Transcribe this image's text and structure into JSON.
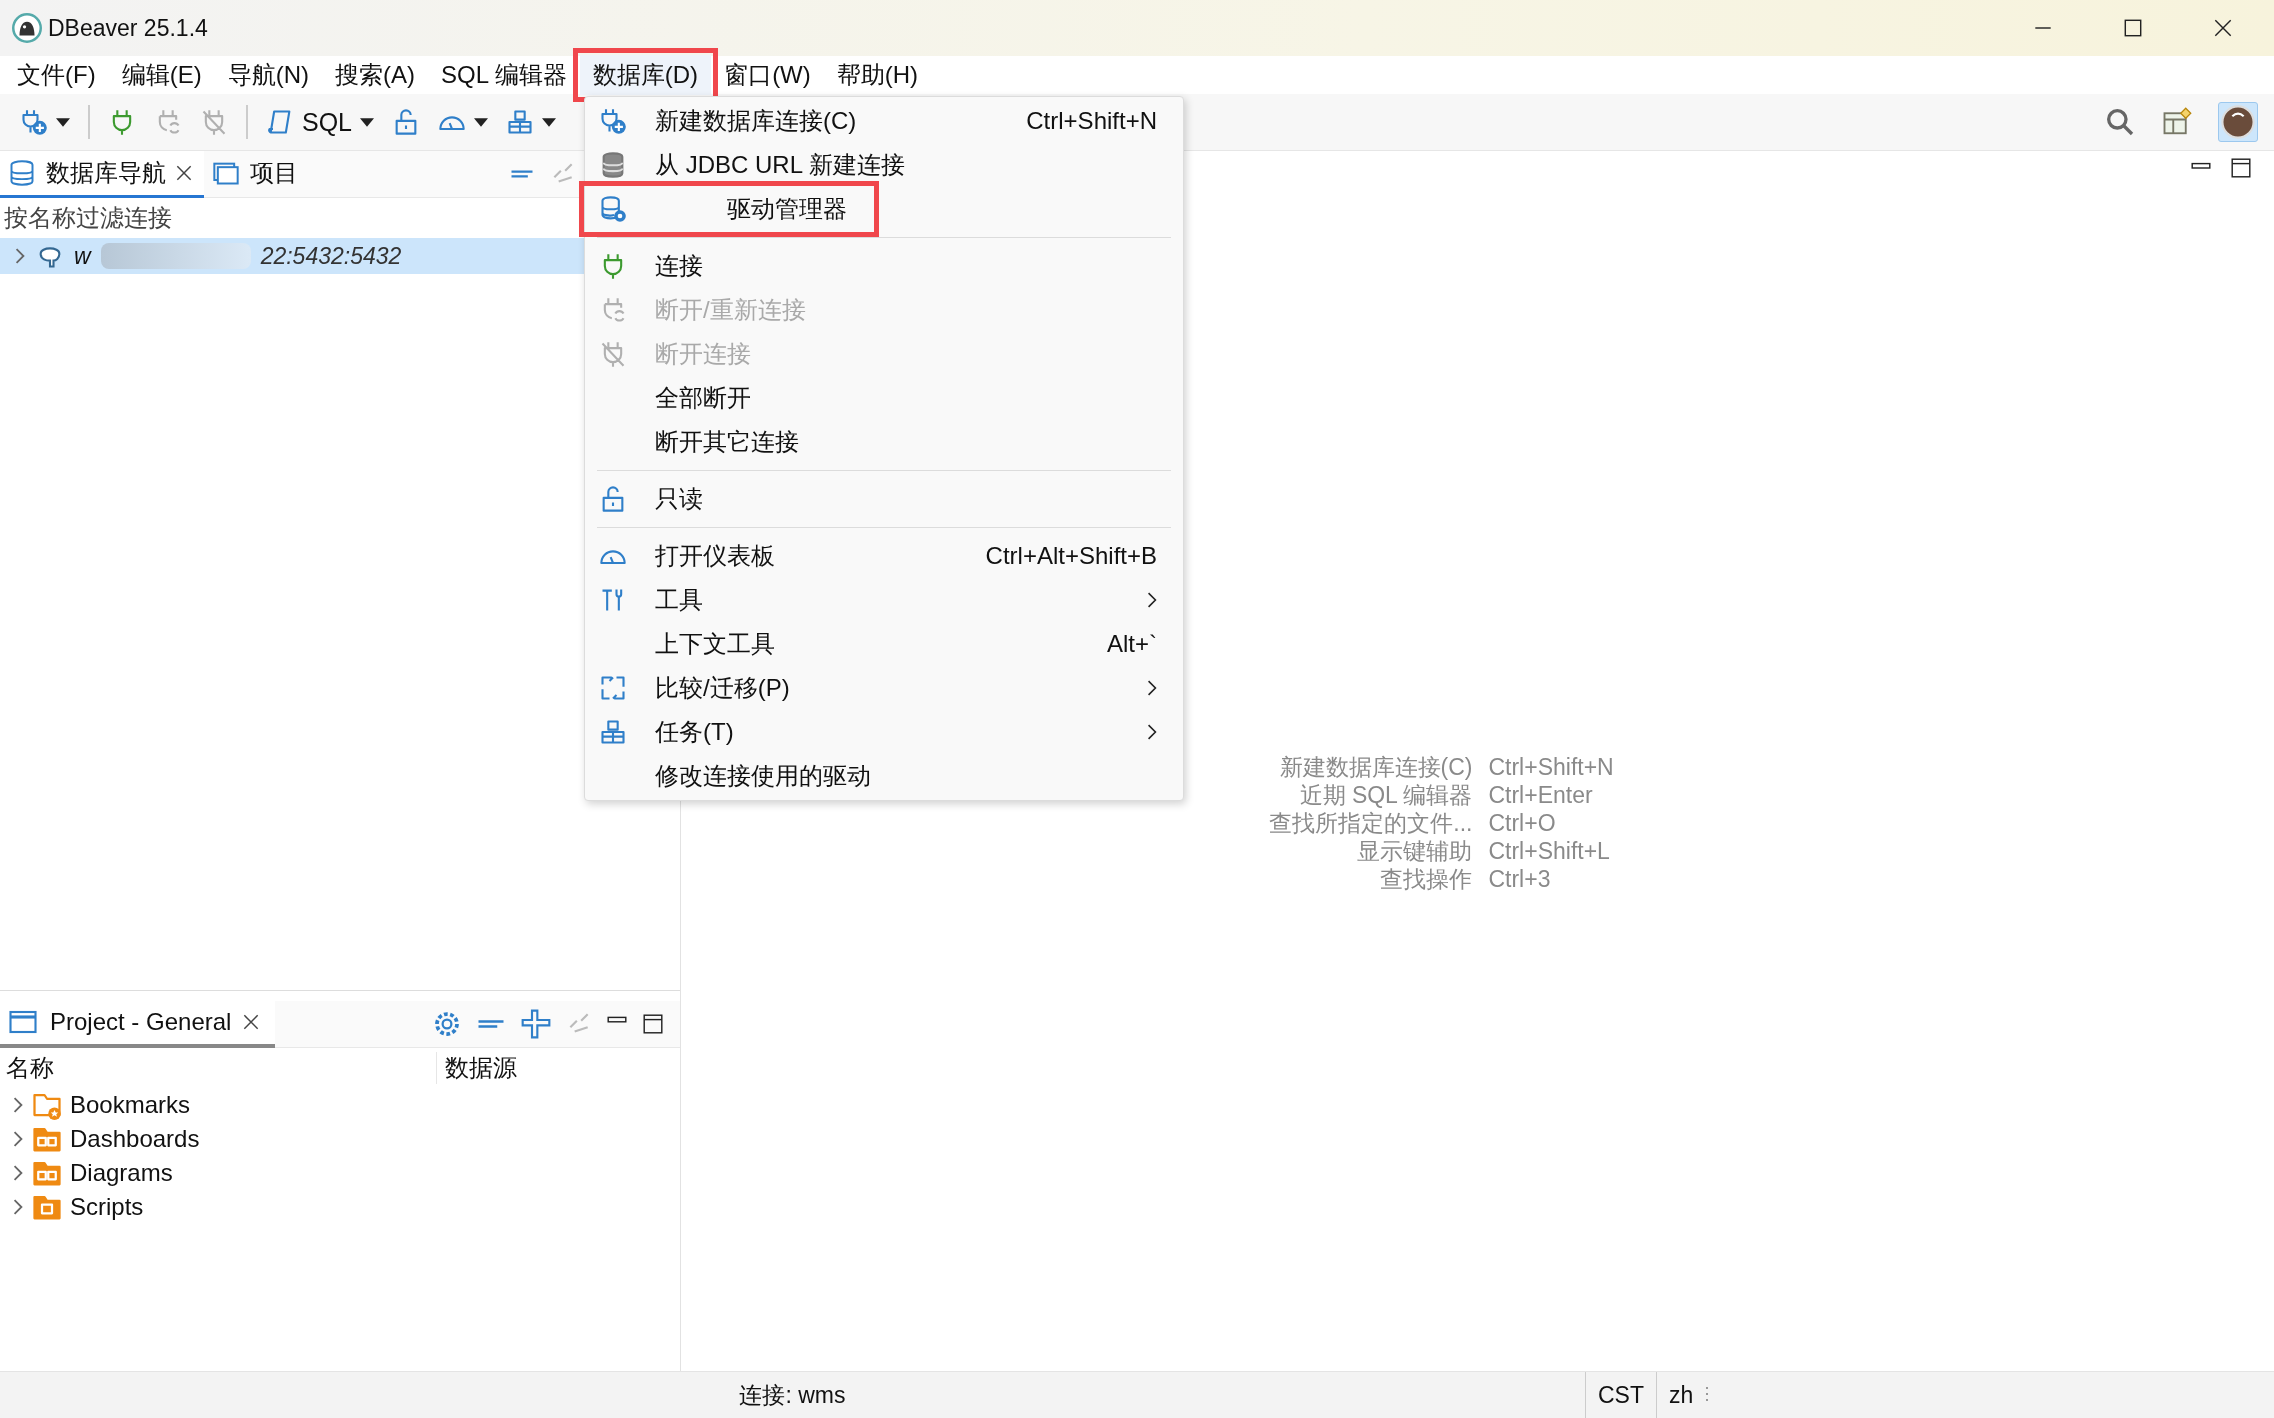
{
  "window": {
    "title": "DBeaver 25.1.4"
  },
  "menu_bar": [
    {
      "label": "文件(F)",
      "selected": false,
      "highlighted": false
    },
    {
      "label": "编辑(E)",
      "selected": false,
      "highlighted": false
    },
    {
      "label": "导航(N)",
      "selected": false,
      "highlighted": false
    },
    {
      "label": "搜索(A)",
      "selected": false,
      "highlighted": false
    },
    {
      "label": "SQL 编辑器",
      "selected": false,
      "highlighted": false
    },
    {
      "label": "数据库(D)",
      "selected": true,
      "highlighted": true
    },
    {
      "label": "窗口(W)",
      "selected": false,
      "highlighted": false
    },
    {
      "label": "帮助(H)",
      "selected": false,
      "highlighted": false
    }
  ],
  "toolbar": [
    {
      "kind": "plug-plus",
      "dropdown": true,
      "disabled": false
    },
    {
      "kind": "plug",
      "dropdown": false,
      "disabled": false
    },
    {
      "kind": "plug-cycle",
      "dropdown": false,
      "disabled": true
    },
    {
      "kind": "plug-off",
      "dropdown": false,
      "disabled": true
    },
    {
      "kind": "scroll",
      "label": "SQL",
      "dropdown": true,
      "disabled": false
    },
    {
      "kind": "lock",
      "dropdown": false,
      "disabled": false
    },
    {
      "kind": "gauge",
      "dropdown": true,
      "disabled": false
    },
    {
      "kind": "boxes",
      "dropdown": true,
      "disabled": false
    }
  ],
  "nav_panel": {
    "tabs": [
      {
        "label": "数据库导航",
        "selected": true,
        "closable": true
      },
      {
        "label": "项目",
        "selected": false,
        "closable": false
      }
    ],
    "filter": {
      "placeholder": "按名称过滤连接"
    },
    "connections": [
      {
        "name": "w",
        "address": "22:5432:5432",
        "selected": true,
        "expanded": false,
        "redacted": true
      }
    ]
  },
  "database_menu": [
    {
      "kind": "plug-plus",
      "label": "新建数据库连接(C)",
      "shortcut": "Ctrl+Shift+N",
      "submenu": false,
      "disabled": false,
      "highlighted": false
    },
    {
      "kind": "database",
      "label": "从 JDBC URL 新建连接",
      "submenu": false,
      "disabled": false,
      "highlighted": false
    },
    {
      "kind": "database-gear",
      "label": "驱动管理器",
      "submenu": false,
      "disabled": false,
      "highlighted": true
    },
    {
      "kind": "separator"
    },
    {
      "kind": "plug",
      "label": "连接",
      "submenu": false,
      "disabled": false,
      "highlighted": false
    },
    {
      "kind": "plug-cycle",
      "label": "断开/重新连接",
      "submenu": false,
      "disabled": true,
      "highlighted": false
    },
    {
      "kind": "plug-off",
      "label": "断开连接",
      "submenu": false,
      "disabled": true,
      "highlighted": false
    },
    {
      "kind": "plain",
      "label": "全部断开",
      "submenu": false,
      "disabled": false,
      "highlighted": false
    },
    {
      "kind": "plain",
      "label": "断开其它连接",
      "submenu": false,
      "disabled": false,
      "highlighted": false
    },
    {
      "kind": "separator"
    },
    {
      "kind": "lock",
      "label": "只读",
      "submenu": false,
      "disabled": false,
      "highlighted": false
    },
    {
      "kind": "separator"
    },
    {
      "kind": "gauge",
      "label": "打开仪表板",
      "shortcut": "Ctrl+Alt+Shift+B",
      "submenu": false,
      "disabled": false,
      "highlighted": false
    },
    {
      "kind": "tools",
      "label": "工具",
      "submenu": true,
      "disabled": false,
      "highlighted": false
    },
    {
      "kind": "plain",
      "label": "上下文工具",
      "shortcut": "Alt+`",
      "submenu": false,
      "disabled": false,
      "highlighted": false
    },
    {
      "kind": "compare",
      "label": "比较/迁移(P)",
      "submenu": true,
      "disabled": false,
      "highlighted": false
    },
    {
      "kind": "boxes",
      "label": "任务(T)",
      "submenu": true,
      "disabled": false,
      "highlighted": false
    },
    {
      "kind": "plain",
      "label": "修改连接使用的驱动",
      "submenu": false,
      "disabled": false,
      "highlighted": false
    }
  ],
  "project_panel": {
    "tab": {
      "label": "Project - General",
      "selected": true
    },
    "columns": [
      "名称",
      "数据源"
    ],
    "items": [
      {
        "label": "Bookmarks",
        "kind": "folder-star",
        "expanded": false
      },
      {
        "label": "Dashboards",
        "kind": "folder-panels",
        "expanded": false
      },
      {
        "label": "Diagrams",
        "kind": "folder-panels",
        "expanded": false
      },
      {
        "label": "Scripts",
        "kind": "folder-script",
        "expanded": false
      }
    ]
  },
  "editor_hints": [
    {
      "label": "新建数据库连接(C)",
      "shortcut": "Ctrl+Shift+N"
    },
    {
      "label": "近期 SQL 编辑器",
      "shortcut": "Ctrl+Enter"
    },
    {
      "label": "查找所指定的文件...",
      "shortcut": "Ctrl+O"
    },
    {
      "label": "显示键辅助",
      "shortcut": "Ctrl+Shift+L"
    },
    {
      "label": "查找操作",
      "shortcut": "Ctrl+3"
    }
  ],
  "status_bar": {
    "connection": "连接: wms",
    "timezone": "CST",
    "locale": "zh"
  }
}
